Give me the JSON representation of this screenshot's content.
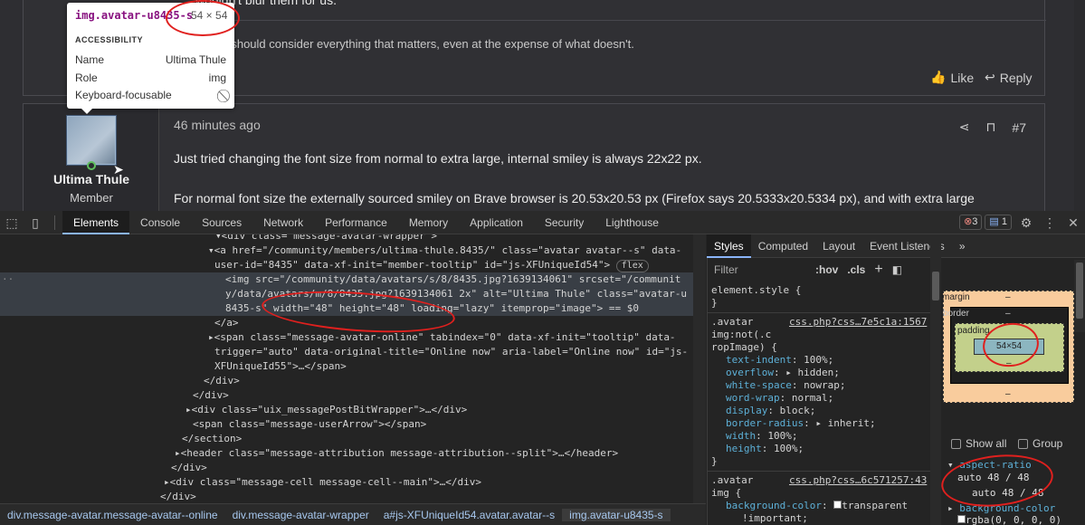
{
  "page": {
    "top_line": "wouldn't blur them for us.",
    "signature": "se should consider everything that matters, even at the expense of what doesn't.",
    "like_label": "Like",
    "reply_label": "Reply",
    "post_time": "46 minutes ago",
    "post_number": "#7",
    "user_name": "Ultima Thule",
    "user_role": "Member",
    "post_text_1": "Just tried changing the font size from normal to extra large, internal smiley is always 22x22 px.",
    "post_text_2": "For normal font size the externally sourced smiley on Brave browser is 20.53x20.53 px (Firefox says 20.5333x20.5334 px), and with extra large"
  },
  "tooltip": {
    "selector": "img.avatar-u8435-s",
    "dimensions": "54 × 54",
    "section": "ACCESSIBILITY",
    "rows": [
      {
        "key": "Name",
        "value": "Ultima Thule"
      },
      {
        "key": "Role",
        "value": "img"
      },
      {
        "key": "Keyboard-focusable",
        "value": "⃠"
      }
    ]
  },
  "devtools": {
    "tabs": [
      "Elements",
      "Console",
      "Sources",
      "Network",
      "Performance",
      "Memory",
      "Application",
      "Security",
      "Lighthouse"
    ],
    "active_tab": "Elements",
    "error_count": "3",
    "message_count": "1",
    "dom_lines": [
      {
        "text": "▾<div class=\"message-avatar-wrapper\">"
      },
      {
        "text": "▾<a href=\"/community/members/ultima-thule.8435/\" class=\"avatar avatar--s\" data-"
      },
      {
        "text": "user-id=\"8435\" data-xf-init=\"member-tooltip\" id=\"js-XFUniqueId54\">"
      },
      {
        "text": "<img src=\"/community/data/avatars/s/8/8435.jpg?1639134061\" srcset=\"/communit"
      },
      {
        "text": "y/data/avatars/m/8/8435.jpg?1639134061 2x\" alt=\"Ultima Thule\" class=\"avatar-u"
      },
      {
        "text": "8435-s\" width=\"48\" height=\"48\" loading=\"lazy\" itemprop=\"image\"> == $0"
      },
      {
        "text": "</a>"
      },
      {
        "text": "▸<span class=\"message-avatar-online\" tabindex=\"0\" data-xf-init=\"tooltip\" data-"
      },
      {
        "text": "trigger=\"auto\" data-original-title=\"Online now\" aria-label=\"Online now\" id=\"js-"
      },
      {
        "text": "XFUniqueId55\">…</span>"
      },
      {
        "text": "</div>"
      },
      {
        "text": "</div>"
      },
      {
        "text": "▸<div class=\"uix_messagePostBitWrapper\">…</div>"
      },
      {
        "text": "<span class=\"message-userArrow\"></span>"
      },
      {
        "text": "</section>"
      },
      {
        "text": "▸<header class=\"message-attribution message-attribution--split\">…</header>"
      },
      {
        "text": "</div>"
      },
      {
        "text": "▸<div class=\"message-cell message-cell--main\">…</div>"
      },
      {
        "text": "</div>"
      }
    ],
    "flex_badge": "flex",
    "breadcrumbs": [
      "div.message-avatar.message-avatar--online",
      "div.message-avatar-wrapper",
      "a#js-XFUniqueId54.avatar.avatar--s",
      "img.avatar-u8435-s"
    ],
    "styles_tabs": [
      "Styles",
      "Computed",
      "Layout",
      "Event Listeners",
      "»"
    ],
    "filter_placeholder": "Filter",
    "hov": ":hov",
    "cls": ".cls",
    "element_style": "element.style {",
    "close_brace": "}",
    "rule1": {
      "selector_1": ".avatar",
      "selector_2": "img:not(.c",
      "selector_3": "ropImage) {",
      "source": "css.php?css…7e5c1a:1567",
      "decls": [
        {
          "prop": "text-indent",
          "val": "100%;"
        },
        {
          "prop": "overflow",
          "val": "▸ hidden;"
        },
        {
          "prop": "white-space",
          "val": "nowrap;"
        },
        {
          "prop": "word-wrap",
          "val": "normal;"
        },
        {
          "prop": "display",
          "val": "block;"
        },
        {
          "prop": "border-radius",
          "val": "▸ inherit;"
        },
        {
          "prop": "width",
          "val": "100%;"
        },
        {
          "prop": "height",
          "val": "100%;"
        }
      ]
    },
    "rule2": {
      "selector_1": ".avatar",
      "selector_2": "img {",
      "source": "css.php?css…6c571257:43",
      "decls": [
        {
          "prop": "background-color",
          "val": "transparent"
        },
        {
          "prop": "",
          "val": "!important;"
        }
      ]
    },
    "boxmodel": {
      "margin_label": "margin",
      "border_label": "border",
      "padding_label": "padding",
      "content": "54×54",
      "dash": "–"
    },
    "show_all": "Show all",
    "group": "Group",
    "computed": [
      {
        "prop": "aspect-ratio",
        "val": "auto 48 / 48"
      },
      {
        "prop": "",
        "val": "auto 48 / 48"
      },
      {
        "prop": "background-color",
        "val": "rgba(0, 0, 0, 0)"
      }
    ]
  },
  "colors": {
    "accent": "#8ab4f8",
    "annotation": "#e0201e",
    "tag": "#5db0d7",
    "attr_value": "#f29766"
  }
}
